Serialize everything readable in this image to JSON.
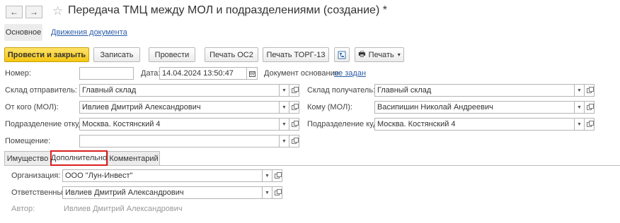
{
  "window": {
    "title": "Передача ТМЦ между МОЛ и подразделениями (создание) *",
    "back_icon": "←",
    "forward_icon": "→",
    "star_icon": "☆"
  },
  "topnav": {
    "main": "Основное",
    "movements": "Движения документа"
  },
  "toolbar": {
    "post_close": "Провести и закрыть",
    "save": "Записать",
    "post": "Провести",
    "print_os2": "Печать ОС2",
    "print_torg13": "Печать ТОРГ-13",
    "print": "Печать",
    "print_icon": "🖶",
    "dropdown_arrow": "▾"
  },
  "form": {
    "number_label": "Номер:",
    "number_value": "",
    "date_label": "Дата:",
    "date_value": "14.04.2024 13:50:47",
    "basis_label": "Документ основание:",
    "basis_value": "не задан",
    "warehouse_from_label": "Склад отправитель:",
    "warehouse_from_value": "Главный склад",
    "warehouse_to_label": "Склад получатель:",
    "warehouse_to_value": "Главный склад",
    "from_mol_label": "От кого (МОЛ):",
    "from_mol_value": "Ивлиев Дмитрий Александрович",
    "to_mol_label": "Кому (МОЛ):",
    "to_mol_value": "Васипишин Николай Андреевич",
    "dept_from_label": "Подразделение откуда:",
    "dept_from_value": "Москва. Костянский 4",
    "dept_to_label": "Подразделение куда:",
    "dept_to_value": "Москва. Костянский 4",
    "room_label": "Помещение:",
    "room_value": ""
  },
  "tabs": {
    "property": "Имущество",
    "additional": "Дополнительно",
    "comment": "Комментарий"
  },
  "additional": {
    "org_label": "Организация:",
    "org_value": "ООО \"Лун-Инвест\"",
    "resp_label": "Ответственный:",
    "resp_value": "Ивлиев Дмитрий Александрович",
    "author_label": "Автор:",
    "author_value": "Ивлиев Дмитрий Александрович"
  },
  "colors": {
    "accent_yellow": "#f6c613",
    "link_blue": "#2b5fa8",
    "highlight_red": "#d9201f"
  }
}
